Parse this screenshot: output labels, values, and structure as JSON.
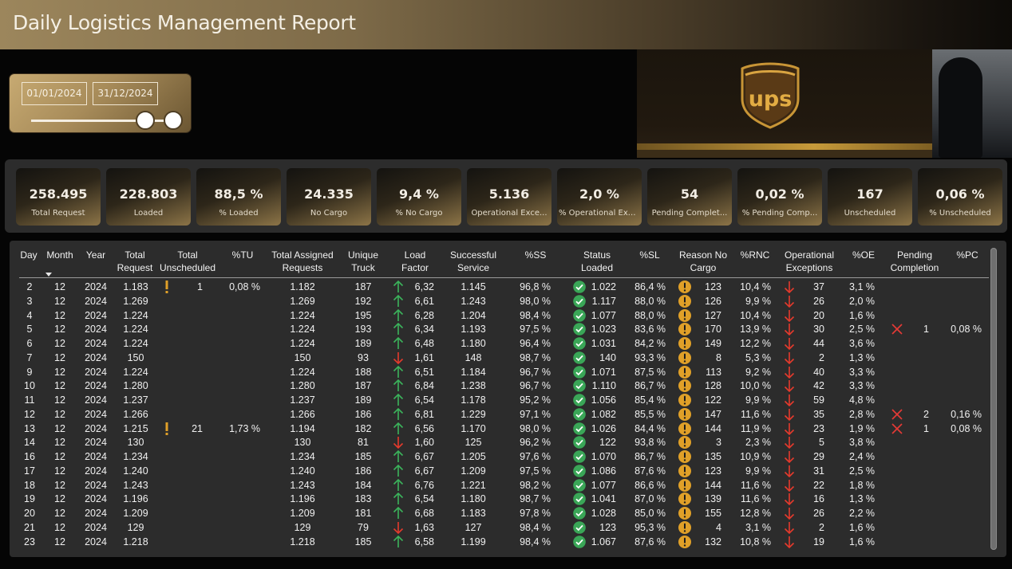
{
  "title": "Daily Logistics Management Report",
  "logo_text": "ups",
  "date_filter": {
    "start": "01/01/2024",
    "end": "31/12/2024"
  },
  "colors": {
    "gold": "#c7aa72",
    "green_arrow": "#3bb35b",
    "red_arrow": "#e53a2c",
    "ok_check": "#3aa657",
    "warn": "#e0a028",
    "cross": "#e33a36"
  },
  "kpis": [
    {
      "value": "258.495",
      "label": "Total Request"
    },
    {
      "value": "228.803",
      "label": "Loaded"
    },
    {
      "value": "88,5 %",
      "label": "% Loaded"
    },
    {
      "value": "24.335",
      "label": "No Cargo"
    },
    {
      "value": "9,4 %",
      "label": "% No Cargo"
    },
    {
      "value": "5.136",
      "label": "Operational Exce..."
    },
    {
      "value": "2,0 %",
      "label": "% Operational Exce..."
    },
    {
      "value": "54",
      "label": "Pending Complet..."
    },
    {
      "value": "0,02 %",
      "label": "% Pending Comp..."
    },
    {
      "value": "167",
      "label": "Unscheduled"
    },
    {
      "value": "0,06 %",
      "label": "% Unscheduled"
    }
  ],
  "table": {
    "headers": [
      "Day",
      "Month",
      "Year",
      "Total\nRequest",
      "Total\nUnscheduled",
      "%TU",
      "Total Assigned\nRequests",
      "Unique\nTruck",
      "Load\nFactor",
      "Successful\nService",
      "%SS",
      "Status\nLoaded",
      "%SL",
      "Reason No\nCargo",
      "%RNC",
      "Operational\nExceptions",
      "%OE",
      "Pending\nCompletion",
      "%PC"
    ],
    "sort_icon": "sort-descending-caret",
    "rows": [
      {
        "day": "2",
        "month": "12",
        "year": "2024",
        "req": "1.183",
        "unsch": "1",
        "tu": "0,08 %",
        "assigned": "1.182",
        "truck": "187",
        "lf_dir": "up",
        "lf": "6,32",
        "ss": "1.145",
        "pss": "96,8 %",
        "loaded": "1.022",
        "psl": "86,4 %",
        "rnc": "123",
        "prnc": "10,4 %",
        "oe": "37",
        "poe": "3,1 %",
        "pend": "",
        "ppc": ""
      },
      {
        "day": "3",
        "month": "12",
        "year": "2024",
        "req": "1.269",
        "unsch": "",
        "tu": "",
        "assigned": "1.269",
        "truck": "192",
        "lf_dir": "up",
        "lf": "6,61",
        "ss": "1.243",
        "pss": "98,0 %",
        "loaded": "1.117",
        "psl": "88,0 %",
        "rnc": "126",
        "prnc": "9,9 %",
        "oe": "26",
        "poe": "2,0 %",
        "pend": "",
        "ppc": ""
      },
      {
        "day": "4",
        "month": "12",
        "year": "2024",
        "req": "1.224",
        "unsch": "",
        "tu": "",
        "assigned": "1.224",
        "truck": "195",
        "lf_dir": "up",
        "lf": "6,28",
        "ss": "1.204",
        "pss": "98,4 %",
        "loaded": "1.077",
        "psl": "88,0 %",
        "rnc": "127",
        "prnc": "10,4 %",
        "oe": "20",
        "poe": "1,6 %",
        "pend": "",
        "ppc": ""
      },
      {
        "day": "5",
        "month": "12",
        "year": "2024",
        "req": "1.224",
        "unsch": "",
        "tu": "",
        "assigned": "1.224",
        "truck": "193",
        "lf_dir": "up",
        "lf": "6,34",
        "ss": "1.193",
        "pss": "97,5 %",
        "loaded": "1.023",
        "psl": "83,6 %",
        "rnc": "170",
        "prnc": "13,9 %",
        "oe": "30",
        "poe": "2,5 %",
        "pend": "1",
        "ppc": "0,08 %"
      },
      {
        "day": "6",
        "month": "12",
        "year": "2024",
        "req": "1.224",
        "unsch": "",
        "tu": "",
        "assigned": "1.224",
        "truck": "189",
        "lf_dir": "up",
        "lf": "6,48",
        "ss": "1.180",
        "pss": "96,4 %",
        "loaded": "1.031",
        "psl": "84,2 %",
        "rnc": "149",
        "prnc": "12,2 %",
        "oe": "44",
        "poe": "3,6 %",
        "pend": "",
        "ppc": ""
      },
      {
        "day": "7",
        "month": "12",
        "year": "2024",
        "req": "150",
        "unsch": "",
        "tu": "",
        "assigned": "150",
        "truck": "93",
        "lf_dir": "down",
        "lf": "1,61",
        "ss": "148",
        "pss": "98,7 %",
        "loaded": "140",
        "psl": "93,3 %",
        "rnc": "8",
        "prnc": "5,3 %",
        "oe": "2",
        "poe": "1,3 %",
        "pend": "",
        "ppc": ""
      },
      {
        "day": "9",
        "month": "12",
        "year": "2024",
        "req": "1.224",
        "unsch": "",
        "tu": "",
        "assigned": "1.224",
        "truck": "188",
        "lf_dir": "up",
        "lf": "6,51",
        "ss": "1.184",
        "pss": "96,7 %",
        "loaded": "1.071",
        "psl": "87,5 %",
        "rnc": "113",
        "prnc": "9,2 %",
        "oe": "40",
        "poe": "3,3 %",
        "pend": "",
        "ppc": ""
      },
      {
        "day": "10",
        "month": "12",
        "year": "2024",
        "req": "1.280",
        "unsch": "",
        "tu": "",
        "assigned": "1.280",
        "truck": "187",
        "lf_dir": "up",
        "lf": "6,84",
        "ss": "1.238",
        "pss": "96,7 %",
        "loaded": "1.110",
        "psl": "86,7 %",
        "rnc": "128",
        "prnc": "10,0 %",
        "oe": "42",
        "poe": "3,3 %",
        "pend": "",
        "ppc": ""
      },
      {
        "day": "11",
        "month": "12",
        "year": "2024",
        "req": "1.237",
        "unsch": "",
        "tu": "",
        "assigned": "1.237",
        "truck": "189",
        "lf_dir": "up",
        "lf": "6,54",
        "ss": "1.178",
        "pss": "95,2 %",
        "loaded": "1.056",
        "psl": "85,4 %",
        "rnc": "122",
        "prnc": "9,9 %",
        "oe": "59",
        "poe": "4,8 %",
        "pend": "",
        "ppc": ""
      },
      {
        "day": "12",
        "month": "12",
        "year": "2024",
        "req": "1.266",
        "unsch": "",
        "tu": "",
        "assigned": "1.266",
        "truck": "186",
        "lf_dir": "up",
        "lf": "6,81",
        "ss": "1.229",
        "pss": "97,1 %",
        "loaded": "1.082",
        "psl": "85,5 %",
        "rnc": "147",
        "prnc": "11,6 %",
        "oe": "35",
        "poe": "2,8 %",
        "pend": "2",
        "ppc": "0,16 %"
      },
      {
        "day": "13",
        "month": "12",
        "year": "2024",
        "req": "1.215",
        "unsch": "21",
        "tu": "1,73 %",
        "assigned": "1.194",
        "truck": "182",
        "lf_dir": "up",
        "lf": "6,56",
        "ss": "1.170",
        "pss": "98,0 %",
        "loaded": "1.026",
        "psl": "84,4 %",
        "rnc": "144",
        "prnc": "11,9 %",
        "oe": "23",
        "poe": "1,9 %",
        "pend": "1",
        "ppc": "0,08 %"
      },
      {
        "day": "14",
        "month": "12",
        "year": "2024",
        "req": "130",
        "unsch": "",
        "tu": "",
        "assigned": "130",
        "truck": "81",
        "lf_dir": "down",
        "lf": "1,60",
        "ss": "125",
        "pss": "96,2 %",
        "loaded": "122",
        "psl": "93,8 %",
        "rnc": "3",
        "prnc": "2,3 %",
        "oe": "5",
        "poe": "3,8 %",
        "pend": "",
        "ppc": ""
      },
      {
        "day": "16",
        "month": "12",
        "year": "2024",
        "req": "1.234",
        "unsch": "",
        "tu": "",
        "assigned": "1.234",
        "truck": "185",
        "lf_dir": "up",
        "lf": "6,67",
        "ss": "1.205",
        "pss": "97,6 %",
        "loaded": "1.070",
        "psl": "86,7 %",
        "rnc": "135",
        "prnc": "10,9 %",
        "oe": "29",
        "poe": "2,4 %",
        "pend": "",
        "ppc": ""
      },
      {
        "day": "17",
        "month": "12",
        "year": "2024",
        "req": "1.240",
        "unsch": "",
        "tu": "",
        "assigned": "1.240",
        "truck": "186",
        "lf_dir": "up",
        "lf": "6,67",
        "ss": "1.209",
        "pss": "97,5 %",
        "loaded": "1.086",
        "psl": "87,6 %",
        "rnc": "123",
        "prnc": "9,9 %",
        "oe": "31",
        "poe": "2,5 %",
        "pend": "",
        "ppc": ""
      },
      {
        "day": "18",
        "month": "12",
        "year": "2024",
        "req": "1.243",
        "unsch": "",
        "tu": "",
        "assigned": "1.243",
        "truck": "184",
        "lf_dir": "up",
        "lf": "6,76",
        "ss": "1.221",
        "pss": "98,2 %",
        "loaded": "1.077",
        "psl": "86,6 %",
        "rnc": "144",
        "prnc": "11,6 %",
        "oe": "22",
        "poe": "1,8 %",
        "pend": "",
        "ppc": ""
      },
      {
        "day": "19",
        "month": "12",
        "year": "2024",
        "req": "1.196",
        "unsch": "",
        "tu": "",
        "assigned": "1.196",
        "truck": "183",
        "lf_dir": "up",
        "lf": "6,54",
        "ss": "1.180",
        "pss": "98,7 %",
        "loaded": "1.041",
        "psl": "87,0 %",
        "rnc": "139",
        "prnc": "11,6 %",
        "oe": "16",
        "poe": "1,3 %",
        "pend": "",
        "ppc": ""
      },
      {
        "day": "20",
        "month": "12",
        "year": "2024",
        "req": "1.209",
        "unsch": "",
        "tu": "",
        "assigned": "1.209",
        "truck": "181",
        "lf_dir": "up",
        "lf": "6,68",
        "ss": "1.183",
        "pss": "97,8 %",
        "loaded": "1.028",
        "psl": "85,0 %",
        "rnc": "155",
        "prnc": "12,8 %",
        "oe": "26",
        "poe": "2,2 %",
        "pend": "",
        "ppc": ""
      },
      {
        "day": "21",
        "month": "12",
        "year": "2024",
        "req": "129",
        "unsch": "",
        "tu": "",
        "assigned": "129",
        "truck": "79",
        "lf_dir": "down",
        "lf": "1,63",
        "ss": "127",
        "pss": "98,4 %",
        "loaded": "123",
        "psl": "95,3 %",
        "rnc": "4",
        "prnc": "3,1 %",
        "oe": "2",
        "poe": "1,6 %",
        "pend": "",
        "ppc": ""
      },
      {
        "day": "23",
        "month": "12",
        "year": "2024",
        "req": "1.218",
        "unsch": "",
        "tu": "",
        "assigned": "1.218",
        "truck": "185",
        "lf_dir": "up",
        "lf": "6,58",
        "ss": "1.199",
        "pss": "98,4 %",
        "loaded": "1.067",
        "psl": "87,6 %",
        "rnc": "132",
        "prnc": "10,8 %",
        "oe": "19",
        "poe": "1,6 %",
        "pend": "",
        "ppc": ""
      }
    ]
  }
}
